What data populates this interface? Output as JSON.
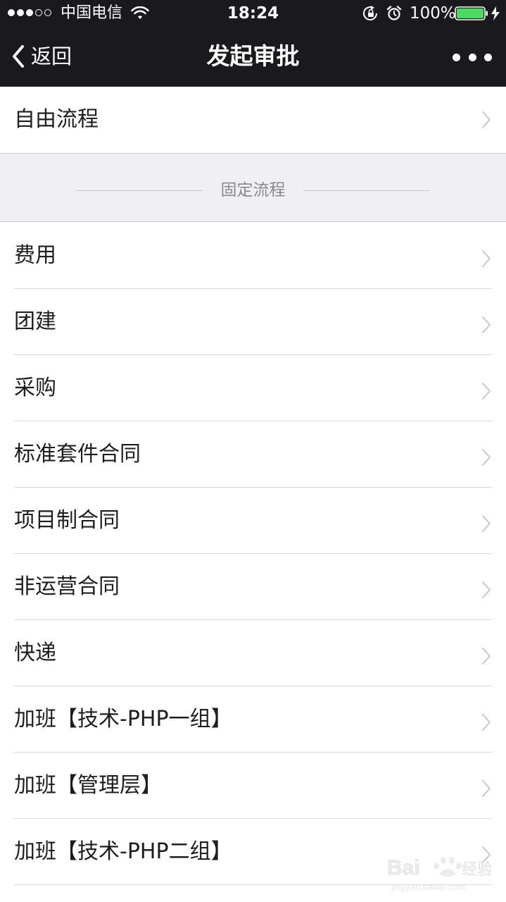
{
  "status_bar": {
    "carrier": "中国电信",
    "time": "18:24",
    "battery_percent": "100%",
    "battery_level": 1.0,
    "signal_strength": 3,
    "signal_max": 5,
    "icons": [
      "signal-dots",
      "wifi-icon",
      "lock-rotation-icon",
      "alarm-icon",
      "battery-icon",
      "bolt-icon"
    ]
  },
  "nav": {
    "back_label": "返回",
    "title": "发起审批",
    "more_icon": "more-dots-icon"
  },
  "free_flow": {
    "label": "自由流程"
  },
  "section": {
    "title": "固定流程"
  },
  "items": [
    {
      "label": "费用"
    },
    {
      "label": "团建"
    },
    {
      "label": "采购"
    },
    {
      "label": "标准套件合同"
    },
    {
      "label": "项目制合同"
    },
    {
      "label": "非运营合同"
    },
    {
      "label": "快递"
    },
    {
      "label": "加班【技术-PHP一组】"
    },
    {
      "label": "加班【管理层】"
    },
    {
      "label": "加班【技术-PHP二组】"
    }
  ],
  "colors": {
    "bar_background": "#1a191e",
    "section_background": "#efeff4",
    "battery_green": "#4cd964",
    "chevron": "#c7c7cc"
  }
}
